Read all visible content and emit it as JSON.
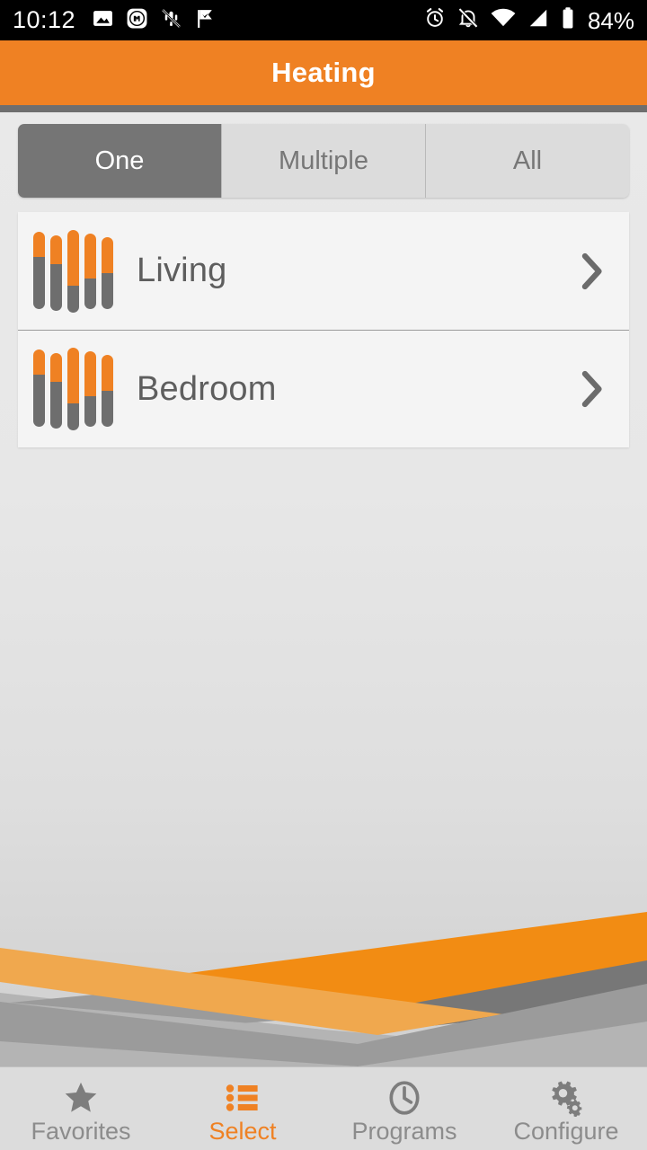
{
  "status_bar": {
    "clock": "10:12",
    "battery_percent": "84%",
    "left_icons": [
      "image-icon",
      "mi-app-icon",
      "vibrate-off-icon",
      "check-flag-icon"
    ],
    "right_icons": [
      "alarm-icon",
      "notifications-off-icon",
      "wifi-icon",
      "cellular-signal-icon",
      "battery-icon"
    ]
  },
  "header": {
    "title": "Heating",
    "background_color": "#ef8123"
  },
  "segmented_control": {
    "selected": "One",
    "options": [
      {
        "label": "One",
        "active": true
      },
      {
        "label": "Multiple",
        "active": false
      },
      {
        "label": "All",
        "active": false
      }
    ],
    "active_color": "#757575",
    "inactive_color": "#dcdcdc"
  },
  "room_list": {
    "rows": [
      {
        "label": "Living",
        "icon": "radiator-icon",
        "chevron": "chevron-right-icon"
      },
      {
        "label": "Bedroom",
        "icon": "radiator-icon",
        "chevron": "chevron-right-icon"
      }
    ]
  },
  "bottom_nav": {
    "active": "Select",
    "items": [
      {
        "label": "Favorites",
        "icon": "star-icon",
        "active": false
      },
      {
        "label": "Select",
        "icon": "list-icon",
        "active": true
      },
      {
        "label": "Programs",
        "icon": "clock-icon",
        "active": false
      },
      {
        "label": "Configure",
        "icon": "gears-icon",
        "active": false
      }
    ],
    "active_color": "#ef8123",
    "inactive_color": "#8c8c8c"
  },
  "decoration": {
    "name": "diagonal-ribbons",
    "colors": {
      "orange_bright": "#f28c13",
      "orange_light": "#f0a84e",
      "gray_dark": "#777777",
      "gray_mid": "#9b9b9b",
      "gray_light": "#b4b4b4"
    }
  }
}
